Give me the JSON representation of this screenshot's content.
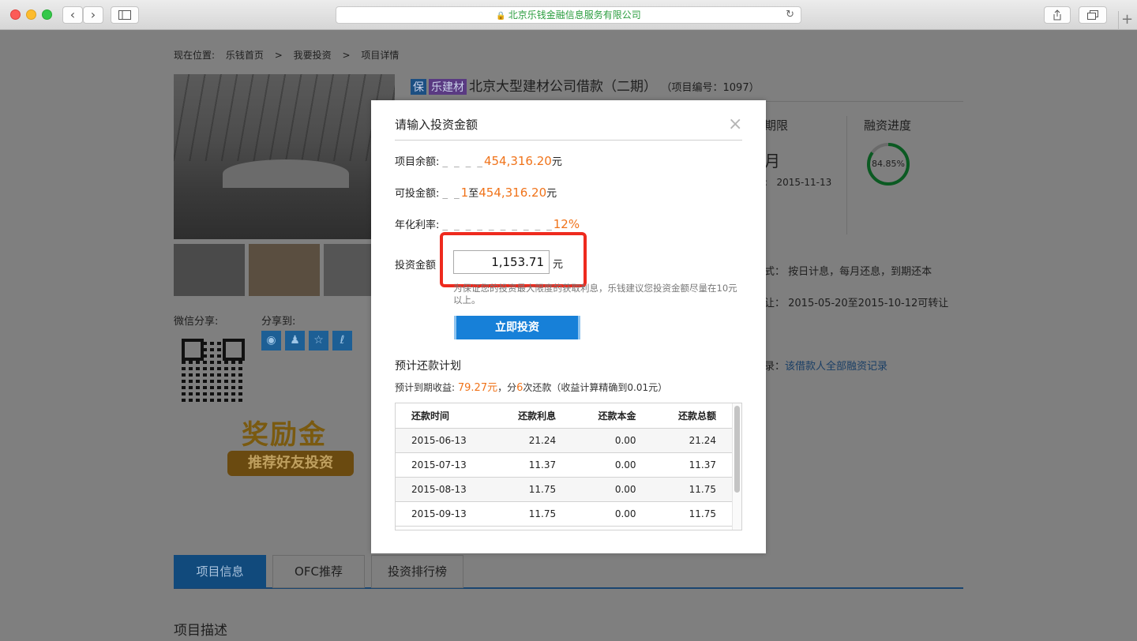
{
  "browser": {
    "url_title": "北京乐钱金融信息服务有限公司",
    "back_icon": "chevron-left",
    "forward_icon": "chevron-right",
    "sidebar_icon": "sidebar",
    "share_icon": "share",
    "tabs_icon": "tabs",
    "reload_icon": "reload",
    "newtab_label": "+"
  },
  "breadcrumb": {
    "prefix": "现在位置:",
    "items": [
      "乐钱首页",
      ">",
      "我要投资",
      ">",
      "项目详情"
    ]
  },
  "share": {
    "wechat_label": "微信分享:",
    "share_to_label": "分享到:"
  },
  "reward": {
    "big": "奖励金",
    "small": "推荐好友投资"
  },
  "project": {
    "tag_bao": "保",
    "tag_le": "乐建材",
    "title": "北京大型建材公司借款（二期）",
    "number": "（项目编号：1097）",
    "period_label": "期限",
    "period_value_fragment": "月",
    "date_fragment": "2015-11-13",
    "progress_label": "融资进度",
    "progress_value": "84.85%",
    "progress_fraction": 0.8485,
    "repay_fragment": "式：  按日计息，每月还息，到期还本",
    "transfer_fragment": "让：  2015-05-20至2015-10-12可转让",
    "record_fragment": "录：",
    "record_link": "该借款人全部融资记录"
  },
  "tabs": [
    {
      "label": "项目信息",
      "active": true
    },
    {
      "label": "OFC推荐",
      "active": false
    },
    {
      "label": "投资排行榜",
      "active": false
    }
  ],
  "description_title": "项目描述",
  "modal": {
    "title": "请输入投资金额",
    "close_icon": "×",
    "balance_label": "项目余额:",
    "balance_dots": "_ _ _ _",
    "balance_value": "454,316.20",
    "balance_unit": "元",
    "range_label": "可投金额:",
    "range_dots": "_ _",
    "range_min": "1",
    "range_sep": "至",
    "range_max": "454,316.20",
    "range_unit": "元",
    "rate_label": "年化利率:",
    "rate_dots": "_ _ _ _ _ _ _ _ _ _",
    "rate_value": "12%",
    "amount_label": "投资金额",
    "amount_value": "1,153.71",
    "amount_unit": "元",
    "hint": "为保证您的投资最大限度的获取利息，乐钱建议您投资金额尽量在10元以上。",
    "invest_button": "立即投资",
    "plan_title": "预计还款计划",
    "plan_sub_prefix": "预计到期收益:",
    "plan_income": "79.27元",
    "plan_mid": "，分",
    "plan_count": "6",
    "plan_suffix": "次还款（收益计算精确到0.01元）",
    "table": {
      "headers": [
        "还款时间",
        "还款利息",
        "还款本金",
        "还款总额"
      ],
      "rows": [
        [
          "2015-06-13",
          "21.24",
          "0.00",
          "21.24"
        ],
        [
          "2015-07-13",
          "11.37",
          "0.00",
          "11.37"
        ],
        [
          "2015-08-13",
          "11.75",
          "0.00",
          "11.75"
        ],
        [
          "2015-09-13",
          "11.75",
          "0.00",
          "11.75"
        ]
      ]
    }
  }
}
